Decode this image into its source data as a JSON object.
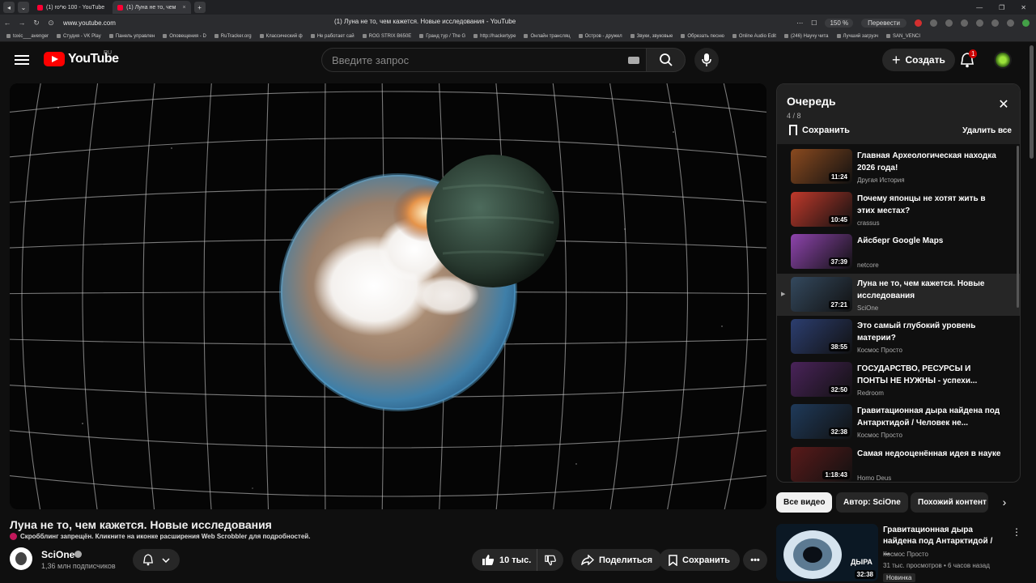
{
  "browser": {
    "tabs": [
      {
        "label": "(1) го*ю 100 - YouTube",
        "active": false
      },
      {
        "label": "(1) Луна не то, чем",
        "active": true
      }
    ],
    "url": "www.youtube.com",
    "page_title": "(1) Луна не то, чем кажется. Новые исследования - YouTube",
    "zoom": "150 %",
    "translate": "Перевести",
    "bookmarks": [
      "toxic___avenger",
      "Студия - VK Play",
      "Панель управлен",
      "Оповещения - D",
      "RuTracker.org",
      "Классический ф",
      "Не работает сай",
      "ROG STRIX B650E",
      "Гранд тур / The G",
      "http://hackertype",
      "Онлайн трансляц",
      "Остров - дружел",
      "Звуки, звуковые",
      "Обрезать песню",
      "Online Audio Edit",
      "(246) Научу чита",
      "Лучший загрузч",
      "SAN_VENCI"
    ]
  },
  "masthead": {
    "logo_text": "YouTube",
    "region": "RU",
    "search_placeholder": "Введите запрос",
    "create_label": "Создать",
    "notification_count": "1"
  },
  "video": {
    "title": "Луна не то, чем кажется. Новые исследования",
    "scrobbler_notice": "Скробблинг запрещён. Кликните на иконке расширения Web Scrobbler для подробностей.",
    "channel": "SciOne",
    "subscribers": "1,36 млн подписчиков",
    "likes": "10 тыс.",
    "share_label": "Поделиться",
    "save_label": "Сохранить"
  },
  "queue": {
    "title": "Очередь",
    "count": "4 / 8",
    "save_label": "Сохранить",
    "remove_all_label": "Удалить все",
    "items": [
      {
        "title": "Главная Археологическая находка 2026 года!",
        "channel": "Другая История",
        "duration": "11:24",
        "color": "#8a4a1f"
      },
      {
        "title": "Почему японцы не хотят жить в этих местах?",
        "channel": "crassus",
        "duration": "10:45",
        "color": "#c0392b"
      },
      {
        "title": "Айсберг Google Maps",
        "channel": "netcore",
        "duration": "37:39",
        "color": "#8e44ad"
      },
      {
        "title": "Луна не то, чем кажется. Новые исследования",
        "channel": "SciOne",
        "duration": "27:21",
        "color": "#34495e",
        "current": true
      },
      {
        "title": "Это самый глубокий уровень материи?",
        "channel": "Космос Просто",
        "duration": "38:55",
        "color": "#2c3e70"
      },
      {
        "title": "ГОСУДАРСТВО, РЕСУРСЫ И ПОНТЫ НЕ НУЖНЫ - успехи...",
        "channel": "Redroom",
        "duration": "32:50",
        "color": "#4a235a"
      },
      {
        "title": "Гравитационная дыра найдена под Антарктидой / Человек не...",
        "channel": "Космос Просто",
        "duration": "32:38",
        "color": "#1f3a5a"
      },
      {
        "title": "Самая недооценённая идея в науке",
        "channel": "Homo Deus",
        "duration": "1:18:43",
        "color": "#5a1a1a"
      }
    ]
  },
  "chips": [
    "Все видео",
    "Автор: SciOne",
    "Похожий контент"
  ],
  "recommendation": {
    "title": "Гравитационная дыра найдена под Антарктидой / ...",
    "thumb_text": "ДЫРА",
    "channel": "Космос Просто",
    "meta": "31 тыс. просмотров • 6 часов назад",
    "badge": "Новинка",
    "duration": "32:38"
  }
}
